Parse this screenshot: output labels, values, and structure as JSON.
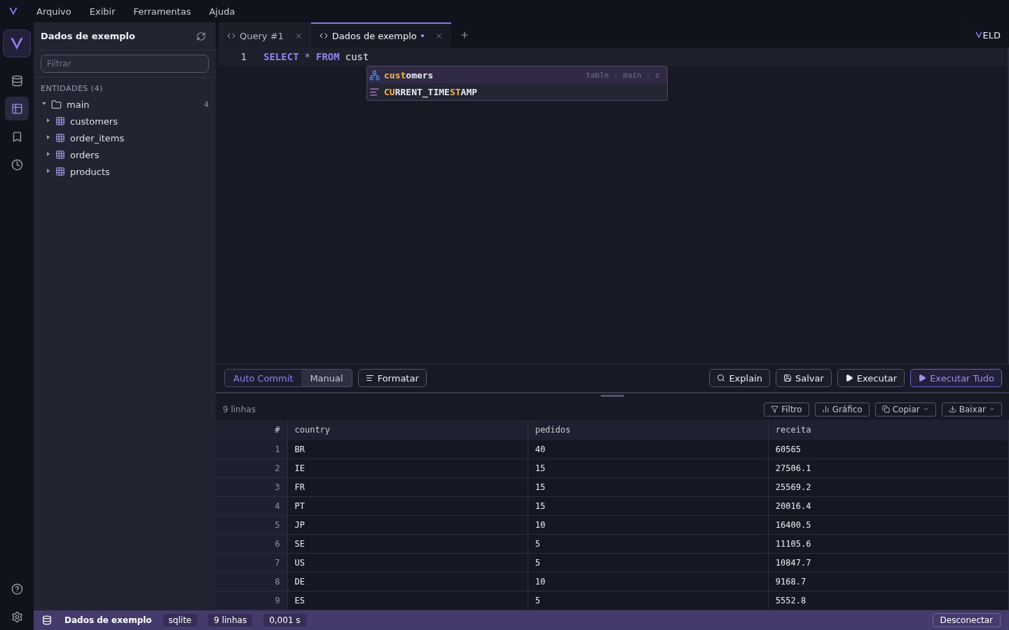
{
  "menu": [
    "Arquivo",
    "Exibir",
    "Ferramentas",
    "Ajuda"
  ],
  "rail": [
    {
      "selected": false
    },
    {
      "selected": true
    },
    {
      "selected": false
    },
    {
      "selected": false
    }
  ],
  "sidebar": {
    "title": "Dados de exemplo",
    "filter_placeholder": "Filtrar",
    "section": "ENTIDADES (4)",
    "tree": [
      {
        "label": "main",
        "count": "4",
        "expanded": true,
        "children": [
          {
            "label": "customers",
            "expanded": false
          },
          {
            "label": "order_items",
            "expanded": false
          },
          {
            "label": "orders",
            "expanded": false
          },
          {
            "label": "products",
            "expanded": false
          }
        ]
      }
    ]
  },
  "tabs": [
    {
      "label": "Query #1",
      "selected": false,
      "modified": false
    },
    {
      "label": "Dados de exemplo",
      "selected": true,
      "modified": true
    }
  ],
  "brand": "ELD",
  "editor": {
    "lines": [
      {
        "number": "1",
        "tokens": [
          {
            "text": "SELECT",
            "kind": "keyword"
          },
          {
            "text": "*",
            "kind": "operator"
          },
          {
            "text": "FROM",
            "kind": "keyword"
          },
          {
            "text": "cust",
            "kind": "ident"
          }
        ]
      }
    ],
    "suggestions": [
      {
        "kind": "table",
        "selected": true,
        "parts": [
          {
            "text": "cust",
            "match": true
          },
          {
            "text": "omers",
            "match": false
          }
        ],
        "detail": "table · main · c"
      },
      {
        "kind": "function",
        "selected": false,
        "parts": [
          {
            "text": "CU",
            "match": true
          },
          {
            "text": "RRENT_TIME",
            "match": false
          },
          {
            "text": "ST",
            "match": true
          },
          {
            "text": "AMP",
            "match": false
          }
        ]
      }
    ]
  },
  "commit_modes": [
    {
      "label": "Auto Commit",
      "selected": true
    },
    {
      "label": "Manual",
      "selected": false
    }
  ],
  "format_button": "Formatar",
  "actions": [
    {
      "label": "Explain",
      "primary": false
    },
    {
      "label": "Salvar",
      "primary": false
    },
    {
      "label": "Executar",
      "primary": false
    },
    {
      "label": "Executar Tudo",
      "primary": true
    }
  ],
  "results": {
    "count": "9 linhas",
    "tools": [
      {
        "label": "Filtro",
        "dropdown": false
      },
      {
        "label": "Gráfico",
        "dropdown": false
      },
      {
        "label": "Copiar",
        "dropdown": true
      },
      {
        "label": "Baixar",
        "dropdown": true
      }
    ],
    "columns": [
      "#",
      "country",
      "pedidos",
      "receita"
    ],
    "rows": [
      [
        "1",
        "BR",
        "40",
        "60565"
      ],
      [
        "2",
        "IE",
        "15",
        "27506.1"
      ],
      [
        "3",
        "FR",
        "15",
        "25569.2"
      ],
      [
        "4",
        "PT",
        "15",
        "20016.4"
      ],
      [
        "5",
        "JP",
        "10",
        "16400.5"
      ],
      [
        "6",
        "SE",
        "5",
        "11105.6"
      ],
      [
        "7",
        "US",
        "5",
        "10847.7"
      ],
      [
        "8",
        "DE",
        "10",
        "9168.7"
      ],
      [
        "9",
        "ES",
        "5",
        "5552.8"
      ]
    ]
  },
  "status": {
    "connection": "Dados de exemplo",
    "chips": [
      "sqlite",
      "9 linhas",
      "0,001 s"
    ],
    "disconnect": "Desconectar"
  }
}
